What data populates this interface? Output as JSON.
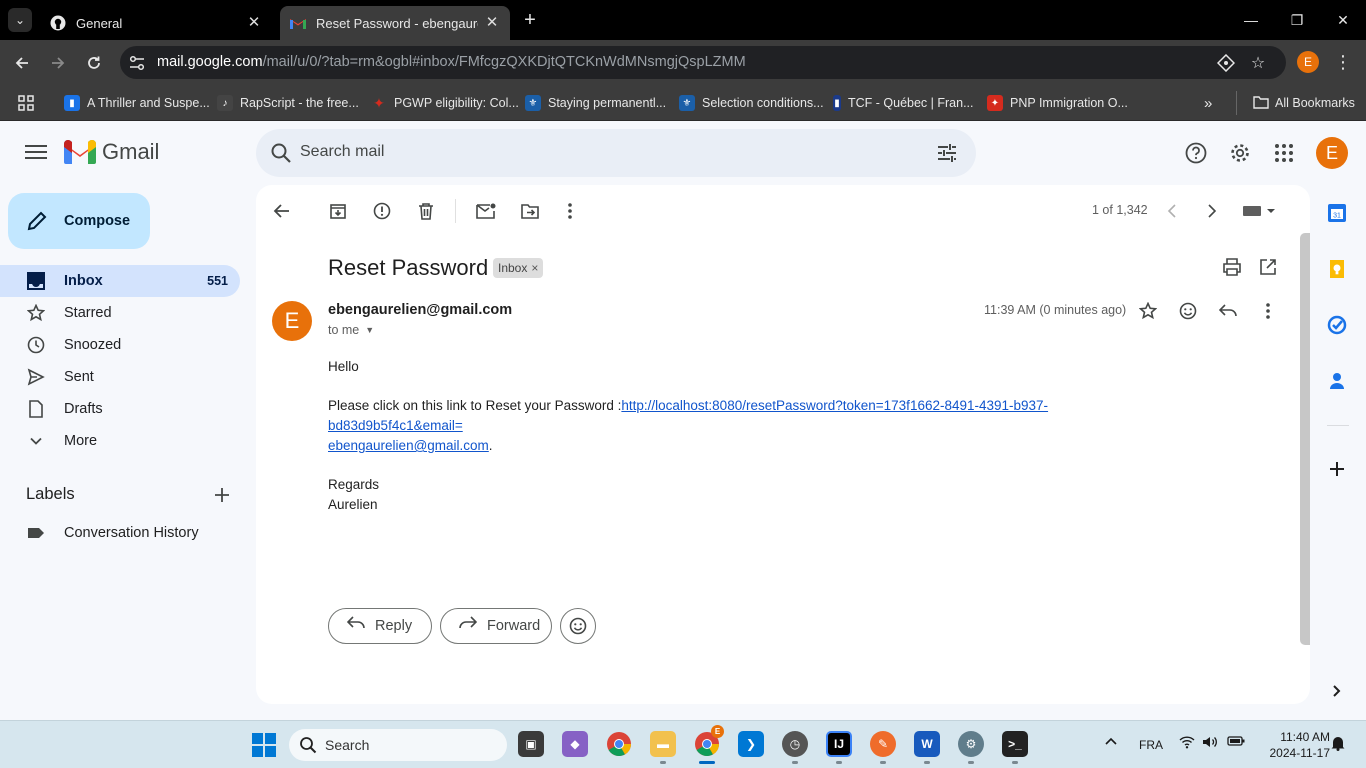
{
  "browser": {
    "tabs": [
      {
        "title": "General",
        "favicon": "github-icon"
      },
      {
        "title": "Reset Password - ebengaurelien",
        "favicon": "gmail-icon",
        "active": true
      }
    ],
    "url_host": "mail.google.com",
    "url_path": "/mail/u/0/?tab=rm&ogbl#inbox/FMfcgzQXKDjtQTCKnWdMNsmgjQspLZMM",
    "profile_initial": "E",
    "bookmarks": [
      {
        "label": "A Thriller and Suspe...",
        "color": "#1a73e8"
      },
      {
        "label": "RapScript - the free...",
        "color": "#444444"
      },
      {
        "label": "PGWP eligibility: Col...",
        "color": "#d52b1e"
      },
      {
        "label": "Staying permanentl...",
        "color": "#1b5fa8"
      },
      {
        "label": "Selection conditions...",
        "color": "#1b5fa8"
      },
      {
        "label": "TCF - Québec | Fran...",
        "color": "#1b3a8a"
      },
      {
        "label": "PNP Immigration O...",
        "color": "#d52b1e"
      }
    ],
    "all_bookmarks": "All Bookmarks"
  },
  "gmail": {
    "brand": "Gmail",
    "search_placeholder": "Search mail",
    "account_initial": "E",
    "compose": "Compose",
    "nav": [
      {
        "label": "Inbox",
        "count": "551",
        "icon": "inbox-icon",
        "active": true
      },
      {
        "label": "Starred",
        "count": "",
        "icon": "star-icon"
      },
      {
        "label": "Snoozed",
        "count": "",
        "icon": "clock-icon"
      },
      {
        "label": "Sent",
        "count": "",
        "icon": "send-icon"
      },
      {
        "label": "Drafts",
        "count": "",
        "icon": "draft-icon"
      },
      {
        "label": "More",
        "count": "",
        "icon": "chevron-down-icon"
      }
    ],
    "labels_heading": "Labels",
    "labels": [
      {
        "label": "Conversation History",
        "icon": "label-icon"
      }
    ],
    "pager": "1 of 1,342",
    "message": {
      "subject": "Reset Password",
      "chip": "Inbox",
      "sender_initial": "E",
      "sender": "ebengaurelien@gmail.com",
      "to": "to me",
      "time": "11:39 AM (0 minutes ago)",
      "greeting": "Hello",
      "line_prefix": "Please click on this link to Reset your Password :",
      "link": "http://localhost:8080/resetPassword?token=173f1662-8491-4391-b937-bd83d9b5f4c1&email=ebengaurelien@gmail.com",
      "link_line1": "http://localhost:8080/resetPassword?token=173f1662-8491-4391-b937-bd83d9b5f4c1&email=",
      "link_line2": "ebengaurelien@gmail.com",
      "link_suffix": ".",
      "closing": "Regards",
      "signature": "Aurelien"
    },
    "reply": "Reply",
    "forward": "Forward",
    "colors": {
      "accent": "#0b57d0",
      "compose_bg": "#c2e7ff",
      "active_nav": "#d3e3fd",
      "avatar": "#e8710a"
    }
  },
  "taskbar": {
    "search": "Search",
    "lang": "FRA",
    "time": "11:40 AM",
    "date": "2024-11-17",
    "browser_badge": "E"
  }
}
